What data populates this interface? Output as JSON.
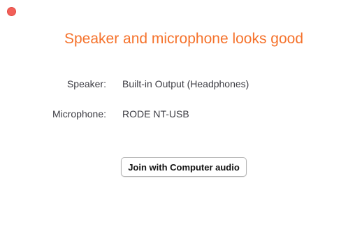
{
  "window": {
    "close_color": "#f25f58"
  },
  "header": {
    "title": "Speaker and microphone looks good",
    "title_color": "#f5722b"
  },
  "devices": {
    "speaker": {
      "label": "Speaker:",
      "value": "Built-in Output (Headphones)"
    },
    "microphone": {
      "label": "Microphone:",
      "value": "RODE NT-USB"
    }
  },
  "actions": {
    "join_label": "Join with Computer audio"
  }
}
